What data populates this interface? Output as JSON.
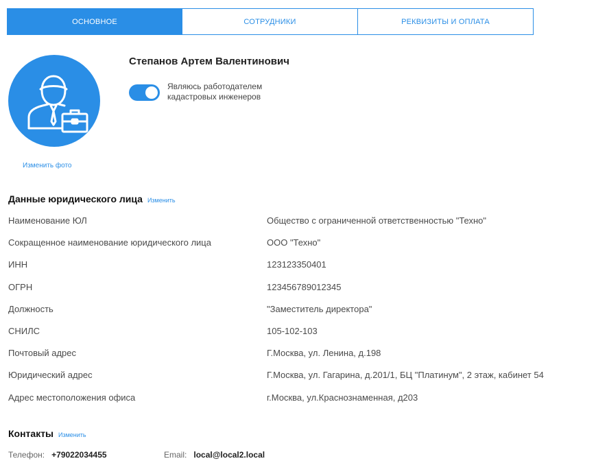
{
  "tabs": [
    {
      "label": "ОСНОВНОЕ",
      "active": true
    },
    {
      "label": "СОТРУДНИКИ",
      "active": false
    },
    {
      "label": "РЕКВИЗИТЫ И ОПЛАТА",
      "active": false
    }
  ],
  "profile": {
    "name": "Степанов Артем Валентинович",
    "change_photo": "Изменить фото",
    "employer_toggle": {
      "label_line1": "Являюсь работодателем",
      "label_line2": "кадастровых инженеров",
      "checked": true
    }
  },
  "legal": {
    "title": "Данные юридического лица",
    "edit": "Изменить",
    "rows": [
      {
        "label": "Наименование ЮЛ",
        "value": "Общество с ограниченной ответственностью \"Техно\""
      },
      {
        "label": "Сокращенное наименование юридического лица",
        "value": "ООО \"Техно\""
      },
      {
        "label": "ИНН",
        "value": "123123350401"
      },
      {
        "label": "ОГРН",
        "value": "123456789012345"
      },
      {
        "label": "Должность",
        "value": "\"Заместитель директора\""
      },
      {
        "label": "СНИЛС",
        "value": "105-102-103"
      },
      {
        "label": "Почтовый адрес",
        "value": "Г.Москва, ул. Ленина, д.198"
      },
      {
        "label": "Юридический адрес",
        "value": "Г.Москва, ул. Гагарина, д.201/1, БЦ \"Платинум\", 2 этаж, кабинет 54"
      },
      {
        "label": "Адрес местоположения офиса",
        "value": "г.Москва, ул.Краснознаменная, д203"
      }
    ]
  },
  "contacts": {
    "title": "Контакты",
    "edit": "Изменить",
    "phone_label": "Телефон:",
    "phone_value": "+79022034455",
    "email_label": "Email:",
    "email_value": "local@local2.local"
  },
  "colors": {
    "accent": "#2a8ee6"
  },
  "icons": {
    "avatar": "employee-briefcase-icon"
  }
}
